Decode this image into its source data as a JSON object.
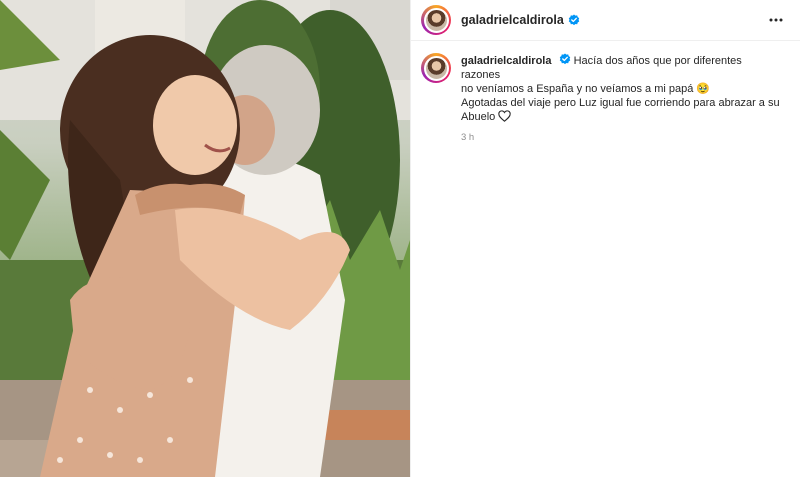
{
  "post": {
    "username": "galadrielcaldirola",
    "verified": true,
    "caption_lines": [
      "Hacía dos años que por diferentes razones",
      "no veníamos a España y no veíamos a mi papá 🥹",
      "Agotadas del viaje pero Luz igual fue corriendo para abrazar a su",
      "Abuelo"
    ],
    "timestamp": "3 h"
  },
  "icons": {
    "more": "more-options-icon",
    "verified": "verified-badge-icon",
    "heart": "heart-outline-icon"
  },
  "colors": {
    "verified_blue": "#0095f6",
    "text": "#262626",
    "muted": "#8e8e8e"
  }
}
